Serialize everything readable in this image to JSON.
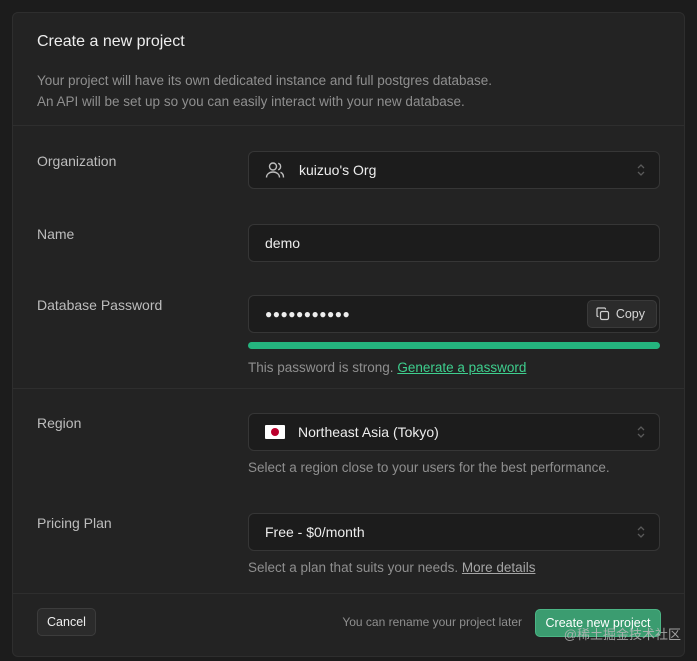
{
  "dialog": {
    "title": "Create a new project",
    "description_line1": "Your project will have its own dedicated instance and full postgres database.",
    "description_line2": "An API will be set up so you can easily interact with your new database."
  },
  "organization": {
    "label": "Organization",
    "value": "kuizuo's Org",
    "icon": "users-icon"
  },
  "name": {
    "label": "Name",
    "value": "demo"
  },
  "password": {
    "label": "Database Password",
    "value": "●●●●●●●●●●●",
    "copy_label": "Copy",
    "strength_fraction": 1.0,
    "strength_color": "#24b47e",
    "help_text": "This password is strong.",
    "generate_link": "Generate a password"
  },
  "region": {
    "label": "Region",
    "value": "Northeast Asia (Tokyo)",
    "flag_icon": "japan-flag-icon",
    "help_text": "Select a region close to your users for the best performance."
  },
  "pricing": {
    "label": "Pricing Plan",
    "value": "Free - $0/month",
    "help_text": "Select a plan that suits your needs.",
    "details_link": "More details"
  },
  "footer": {
    "cancel_label": "Cancel",
    "note": "You can rename your project later",
    "create_label": "Create new project"
  },
  "watermark": "@稀土掘金技术社区",
  "colors": {
    "accent": "#3ecf8e",
    "primary_button": "#3b9c70",
    "background": "#232323"
  }
}
